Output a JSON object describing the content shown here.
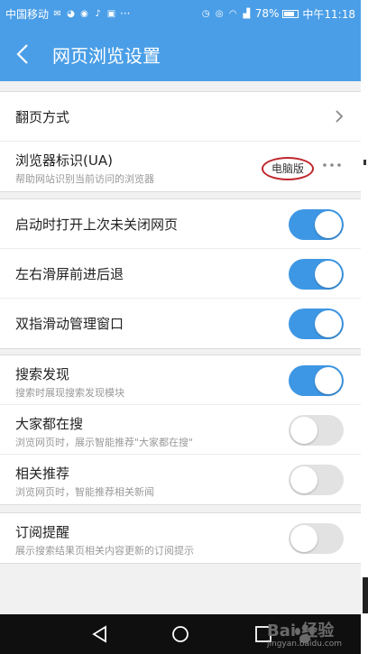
{
  "status_bar": {
    "carrier": "中国移动",
    "extra": "···",
    "battery": "78%",
    "time": "中午11:18"
  },
  "title_bar": {
    "title": "网页浏览设置"
  },
  "group1": {
    "page_turn": {
      "label": "翻页方式"
    },
    "ua": {
      "label": "浏览器标识(UA)",
      "sub": "帮助网站识别当前访问的浏览器",
      "value": "电脑版"
    }
  },
  "group2": {
    "items": [
      {
        "label": "启动时打开上次未关闭网页",
        "on": true
      },
      {
        "label": "左右滑屏前进后退",
        "on": true
      },
      {
        "label": "双指滑动管理窗口",
        "on": true
      }
    ]
  },
  "group3": {
    "items": [
      {
        "label": "搜索发现",
        "sub": "搜索时展现搜索发现模块",
        "on": true
      },
      {
        "label": "大家都在搜",
        "sub": "浏览网页时，展示智能推荐\"大家都在搜\"",
        "on": false
      },
      {
        "label": "相关推荐",
        "sub": "浏览网页时，智能推荐相关新闻",
        "on": false
      }
    ]
  },
  "group4": {
    "items": [
      {
        "label": "订阅提醒",
        "sub": "展示搜索结果页相关内容更新的订阅提示",
        "on": false
      }
    ]
  },
  "watermark": {
    "text": "Bai 经验",
    "sub": "jingyan.baidu.com"
  },
  "colors": {
    "accent": "#4a9ee7",
    "toggle_on": "#3e97e4",
    "toggle_off": "#e2e2e2",
    "highlight_circle": "#c0262b"
  }
}
